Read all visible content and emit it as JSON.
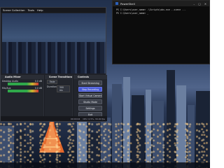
{
  "obs": {
    "menu": [
      "Scene Collection",
      "Tools",
      "Help"
    ],
    "mixer": {
      "title": "Audio Mixer",
      "channels": [
        {
          "name": "Desktop Audio",
          "value": "0.0 dB"
        },
        {
          "name": "Mic/Aux",
          "value": "0.0 dB"
        }
      ]
    },
    "transitions": {
      "title": "Scene Transitions",
      "type_label": "Fade",
      "duration_label": "Duration",
      "duration_value": "300 ms"
    },
    "controls": {
      "title": "Controls",
      "buttons": [
        "Start Streaming",
        "Stop Recording",
        "Start Virtual Camera",
        "Studio Mode",
        "Settings",
        "Exit"
      ]
    },
    "status": {
      "cpu": "CPU: 0.5%, 30.00 fps",
      "time": "00:00:04"
    }
  },
  "powershell": {
    "title": "PowerShell",
    "lines": [
      "PS C:\\Users\\user_name> .\\Scripts\\obs.exe --scene ...",
      "PS C:\\Users\\user_name> _"
    ]
  },
  "colors": {
    "accent": "#4a5bd6",
    "obs_bg": "#1f2128",
    "terminal_bg": "#0c0c0c"
  }
}
